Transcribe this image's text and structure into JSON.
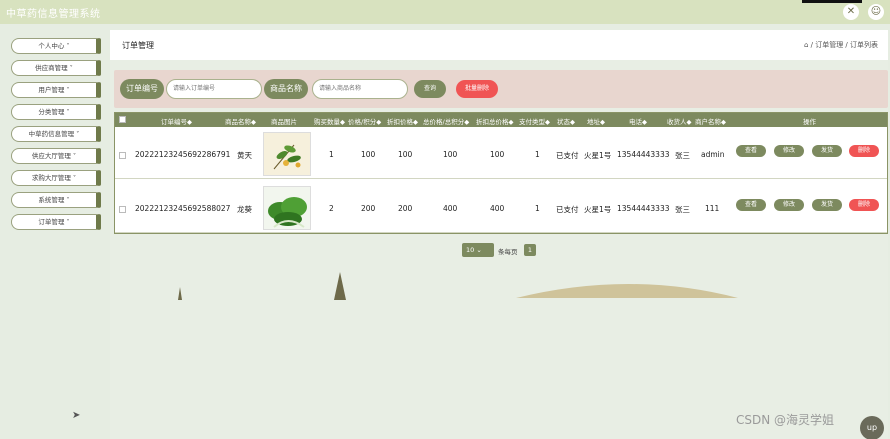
{
  "app": {
    "title": "中草药信息管理系统"
  },
  "topbar": {
    "fullscreen_icon": "expand-icon",
    "user_icon": "user-icon"
  },
  "sidebar": {
    "items": [
      {
        "label": "个人中心 ˅"
      },
      {
        "label": "供应商管理 ˅"
      },
      {
        "label": "用户管理 ˅"
      },
      {
        "label": "分类管理 ˅"
      },
      {
        "label": "中草药信息管理 ˅"
      },
      {
        "label": "供应大厅管理 ˅"
      },
      {
        "label": "求购大厅管理 ˅"
      },
      {
        "label": "系统管理 ˅"
      },
      {
        "label": "订单管理 ˅"
      }
    ]
  },
  "header": {
    "page_title": "订单管理",
    "breadcrumb": "⌂ / 订单管理 / 订单列表"
  },
  "search": {
    "order_no_label": "订单编号",
    "order_no_placeholder": "请输入订单编号",
    "product_label": "商品名称",
    "product_placeholder": "请输入商品名称",
    "query_button": "查询",
    "batch_delete_button": "批量删除"
  },
  "table": {
    "headers": [
      "订单编号◆",
      "商品名称◆",
      "商品图片",
      "购买数量◆",
      "价格/积分◆",
      "折扣价格◆",
      "总价格/总积分◆",
      "折扣总价格◆",
      "支付类型◆",
      "状态◆",
      "地址◆",
      "电话◆",
      "收货人◆",
      "商户名称◆",
      "操作"
    ],
    "rows": [
      {
        "order_no": "20222123245692286791",
        "name": "黄天",
        "qty": "1",
        "price": "100",
        "discount": "100",
        "total": "100",
        "discount_total": "100",
        "pay_type": "1",
        "status": "已支付",
        "address": "火星1号",
        "phone": "13544443333",
        "receiver": "张三",
        "merchant": "admin"
      },
      {
        "order_no": "20222123245692588027",
        "name": "龙葵",
        "qty": "2",
        "price": "200",
        "discount": "200",
        "total": "400",
        "discount_total": "400",
        "pay_type": "1",
        "status": "已支付",
        "address": "火星1号",
        "phone": "13544443333",
        "receiver": "张三",
        "merchant": "111"
      }
    ],
    "actions": {
      "view": "查看",
      "edit": "修改",
      "ship": "发货",
      "delete": "删除"
    }
  },
  "pager": {
    "page_size": "10",
    "per_page_text": "条每页",
    "current_page": "1"
  },
  "watermark": "CSDN @海灵学姐",
  "corner_button": "up",
  "colors": {
    "primary": "#7d8a5f",
    "danger": "#f05454",
    "topbar": "#d8e2bf",
    "search_bg": "#e8d6cf"
  }
}
